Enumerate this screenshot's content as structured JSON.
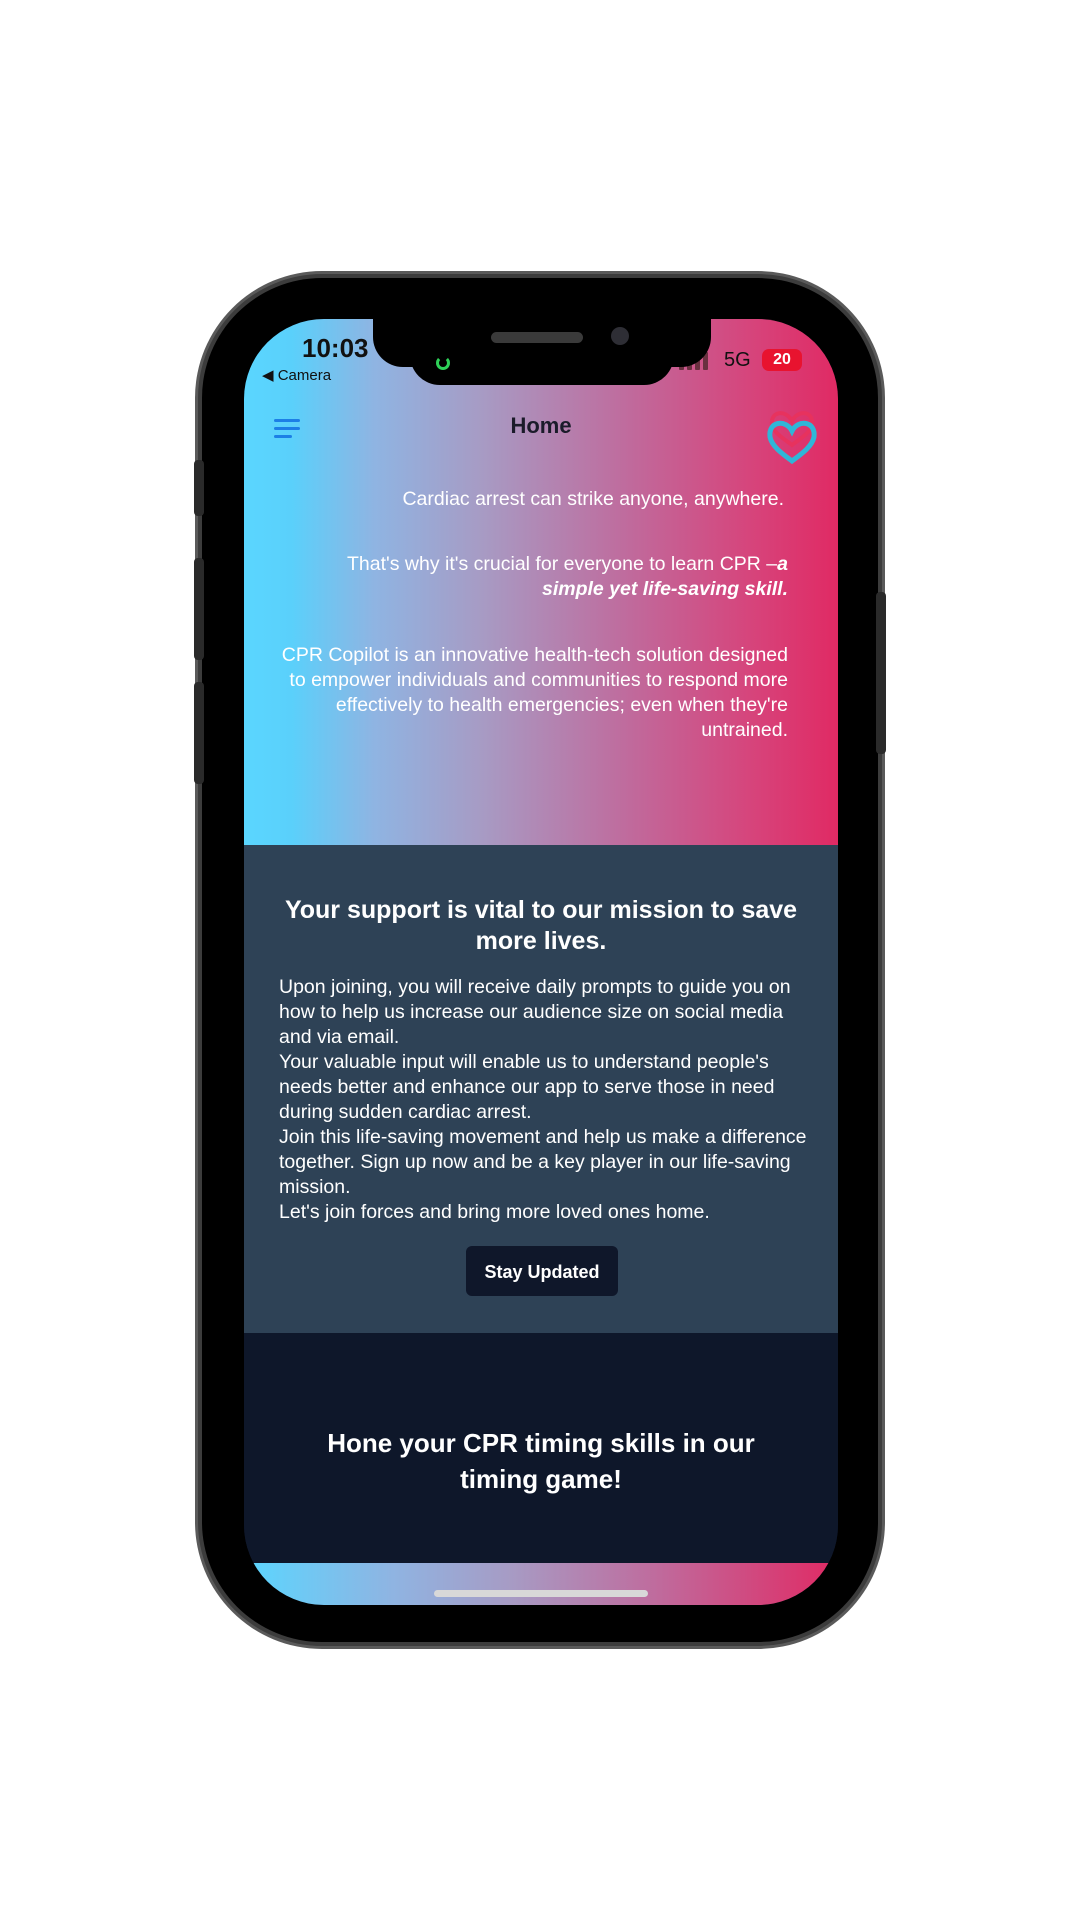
{
  "status_bar": {
    "time": "10:03",
    "back_label": "◀ Camera",
    "network": "5G",
    "battery": "20"
  },
  "nav": {
    "title": "Home",
    "menu_icon": "hamburger-menu-icon",
    "heart_icon": "heart-icon"
  },
  "hero": {
    "line1": "Cardiac arrest can strike anyone, anywhere.",
    "line2_plain": "That's why it's crucial for everyone to learn CPR –",
    "line2_emphasis": "a simple yet life-saving skill.",
    "line3": "CPR Copilot is an innovative health-tech solution designed to empower individuals and communities to respond more effectively to health emergencies; even when they're untrained."
  },
  "support": {
    "title": "Your support is vital to our mission to save more lives.",
    "paragraphs": [
      "Upon joining, you will receive daily prompts to guide you on how to help us increase our audience size on social media and via email.",
      "Your valuable input will enable us to understand people's needs better and enhance our app to serve those in need during sudden cardiac arrest.",
      "Join this life-saving movement and help us make a difference together. Sign up now and be a key player in our life-saving mission.",
      "Let's join forces and bring more loved ones home."
    ],
    "button_label": "Stay Updated"
  },
  "game": {
    "title": "Hone your CPR timing skills in our timing game!"
  },
  "colors": {
    "accent_blue": "#1c7fe6",
    "gradient_left": "#5ad6ff",
    "gradient_right": "#e02a64",
    "support_bg": "#2e4256",
    "dark_bg": "#0f172a"
  }
}
